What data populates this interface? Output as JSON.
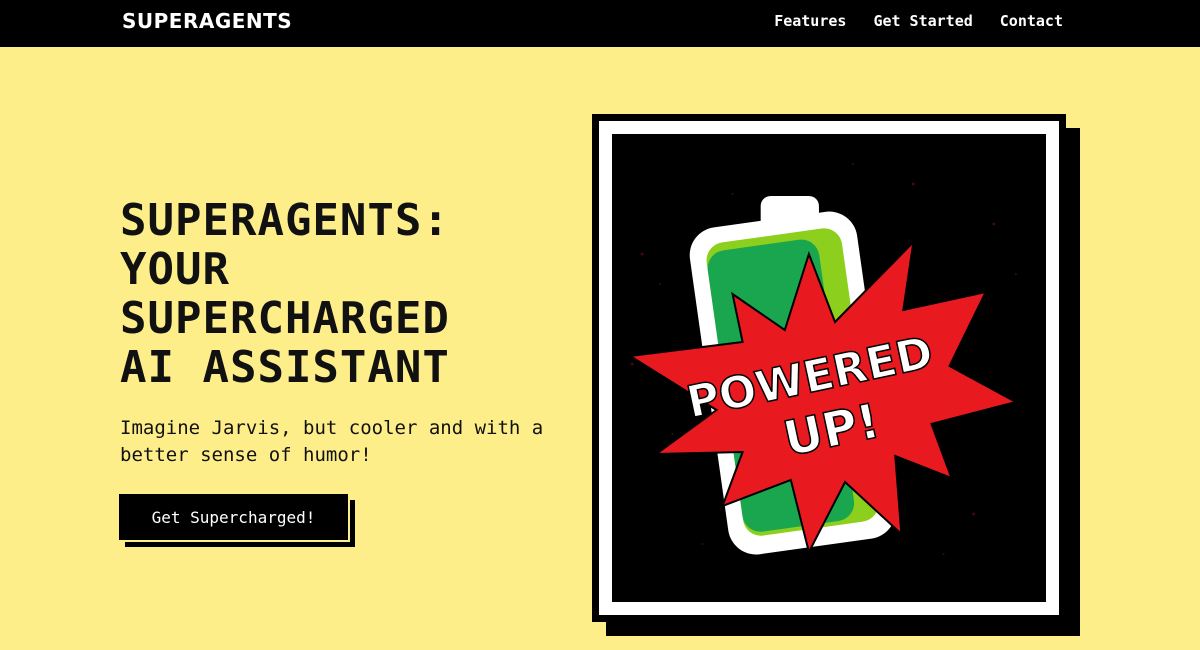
{
  "nav": {
    "logo": "SUPERAGENTS",
    "links": [
      "Features",
      "Get Started",
      "Contact"
    ]
  },
  "hero": {
    "title_lines": [
      "SUPERAGENTS:",
      "YOUR",
      "SUPERCHARGED",
      "AI ASSISTANT"
    ],
    "subtitle": "Imagine Jarvis, but cooler and with a better sense of humor!",
    "cta_label": "Get Supercharged!"
  },
  "image": {
    "line1": "POWERED",
    "line2": "UP!"
  },
  "colors": {
    "background": "#fdee8a",
    "navbar": "#000000",
    "battery_green": "#1aa64f",
    "battery_lime": "#8ccf1d",
    "burst_red": "#e8191f"
  },
  "icons": [
    "battery-icon",
    "starburst-icon"
  ]
}
